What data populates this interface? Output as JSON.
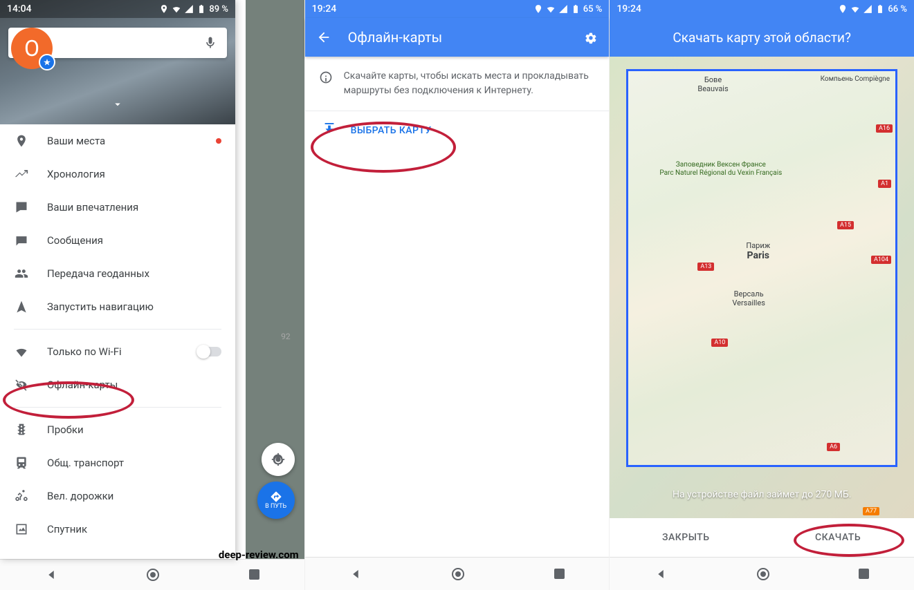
{
  "screen1": {
    "statusbar": {
      "time": "14:04",
      "battery": "89 %"
    },
    "avatar_letter": "O",
    "menu": {
      "places": "Ваши места",
      "timeline": "Хронология",
      "contributions": "Ваши впечатления",
      "messages": "Сообщения",
      "location_sharing": "Передача геоданных",
      "start_navigation": "Запустить навигацию",
      "wifi_only": "Только по Wi-Fi",
      "offline_maps": "Офлайн-карты",
      "traffic": "Пробки",
      "transit": "Общ. транспорт",
      "bike": "Вел. дорожки",
      "satellite": "Спутник"
    },
    "fab_go": "В ПУТЬ",
    "map_label": "92"
  },
  "screen2": {
    "statusbar": {
      "time": "19:24",
      "battery": "65 %"
    },
    "title": "Офлайн-карты",
    "info_text": "Скачайте карты, чтобы искать места и прокладывать маршруты без подключения к Интернету.",
    "select_map": "ВЫБРАТЬ КАРТУ"
  },
  "screen3": {
    "statusbar": {
      "time": "19:24",
      "battery": "66 %"
    },
    "title": "Скачать карту этой области?",
    "map": {
      "city_ru": "Париж",
      "city_en": "Paris",
      "bove": "Бове",
      "beauvais": "Beauvais",
      "compiegne": "Компьень Compiègne",
      "versailles_ru": "Версаль",
      "versailles_en": "Versailles",
      "reserve": "Заповедник Вексен Франсе",
      "park": "Parc Naturel Régional du Vexin Français",
      "roads": [
        "A16",
        "A1",
        "A15",
        "A13",
        "A104",
        "A10",
        "A6",
        "A77"
      ]
    },
    "filesize": "На устройстве файл займет до 270 МБ.",
    "close": "ЗАКРЫТЬ",
    "download": "СКАЧАТЬ"
  },
  "watermark": "deep-review.com"
}
